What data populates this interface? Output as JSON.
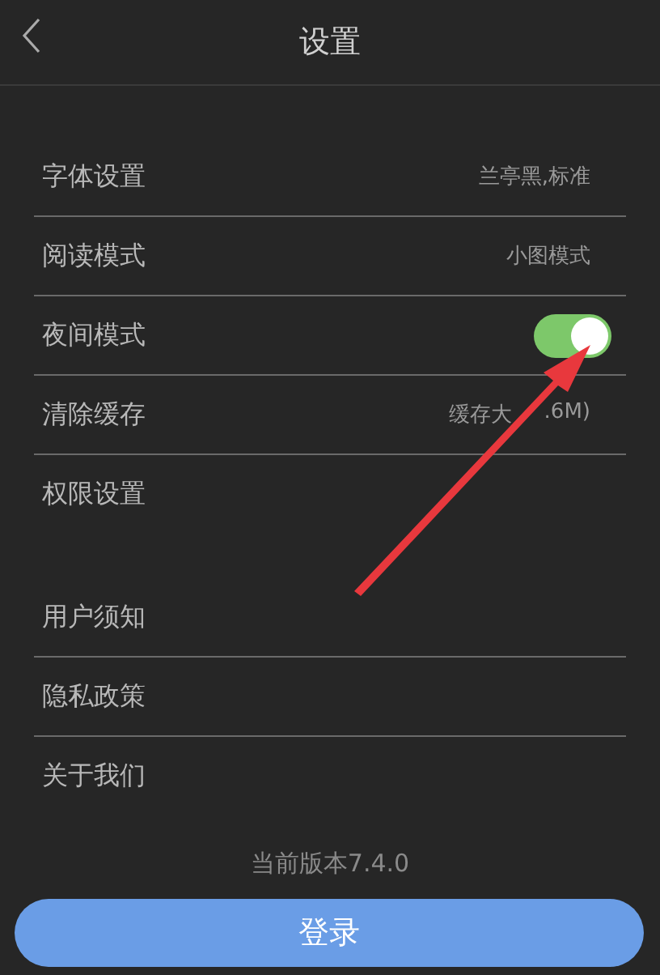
{
  "header": {
    "title": "设置"
  },
  "sections": [
    {
      "rows": [
        {
          "kind": "value",
          "label": "字体设置",
          "value": "兰亭黑,标准"
        },
        {
          "kind": "value",
          "label": "阅读模式",
          "value": "小图模式"
        },
        {
          "kind": "toggle",
          "label": "夜间模式",
          "on": true
        },
        {
          "kind": "split_value",
          "label": "清除缓存",
          "value": "缓存大",
          "value_end": ".6M)"
        },
        {
          "kind": "plain",
          "label": "权限设置"
        }
      ]
    },
    {
      "rows": [
        {
          "kind": "plain",
          "label": "用户须知"
        },
        {
          "kind": "plain",
          "label": "隐私政策"
        },
        {
          "kind": "plain",
          "label": "关于我们"
        }
      ]
    }
  ],
  "version": "当前版本7.4.0",
  "login_button": "登录"
}
